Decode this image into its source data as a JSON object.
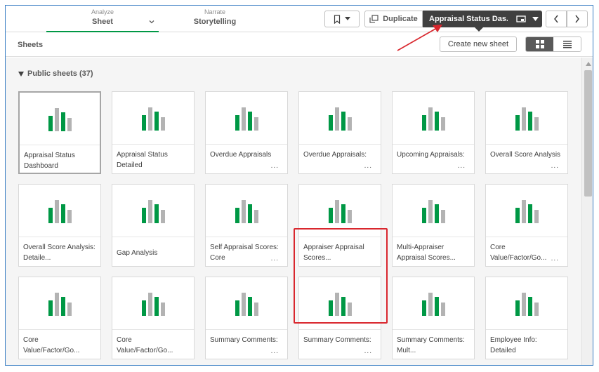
{
  "nav": {
    "analyze": {
      "small": "Analyze",
      "label": "Sheet"
    },
    "narrate": {
      "small": "Narrate",
      "label": "Storytelling"
    },
    "duplicate_label": "Duplicate",
    "current_sheet": "Appraisal Status Das..."
  },
  "sheets_bar": {
    "title": "Sheets",
    "create_label": "Create new sheet"
  },
  "section": {
    "label": "Public sheets (37)"
  },
  "cards": [
    {
      "title": "Appraisal Status Dashboard",
      "dots": ""
    },
    {
      "title": "Appraisal Status Detailed",
      "dots": ""
    },
    {
      "title": "Overdue Appraisals",
      "dots": "..."
    },
    {
      "title": "Overdue Appraisals:",
      "dots": "..."
    },
    {
      "title": "Upcoming Appraisals:",
      "dots": "..."
    },
    {
      "title": "Overall Score Analysis",
      "dots": "..."
    },
    {
      "title": "Overall Score Analysis: Detaile...",
      "dots": ""
    },
    {
      "title": "Gap Analysis",
      "dots": ""
    },
    {
      "title": "Self Appraisal Scores: Core",
      "dots": "..."
    },
    {
      "title": "Appraiser Appraisal Scores...",
      "dots": ""
    },
    {
      "title": "Multi-Appraiser Appraisal Scores...",
      "dots": ""
    },
    {
      "title": "Core Value/Factor/Go...",
      "dots": "..."
    },
    {
      "title": "Core Value/Factor/Go...",
      "dots": ""
    },
    {
      "title": "Core Value/Factor/Go...",
      "dots": ""
    },
    {
      "title": "Summary Comments:",
      "dots": "..."
    },
    {
      "title": "Summary Comments:",
      "dots": "..."
    },
    {
      "title": "Summary Comments: Mult...",
      "dots": ""
    },
    {
      "title": "Employee Info: Detailed",
      "dots": ""
    }
  ],
  "colors": {
    "accent_green": "#009845",
    "bar_gray": "#b3b3b3",
    "highlight_red": "#d9272e",
    "selector_dark": "#404040"
  }
}
